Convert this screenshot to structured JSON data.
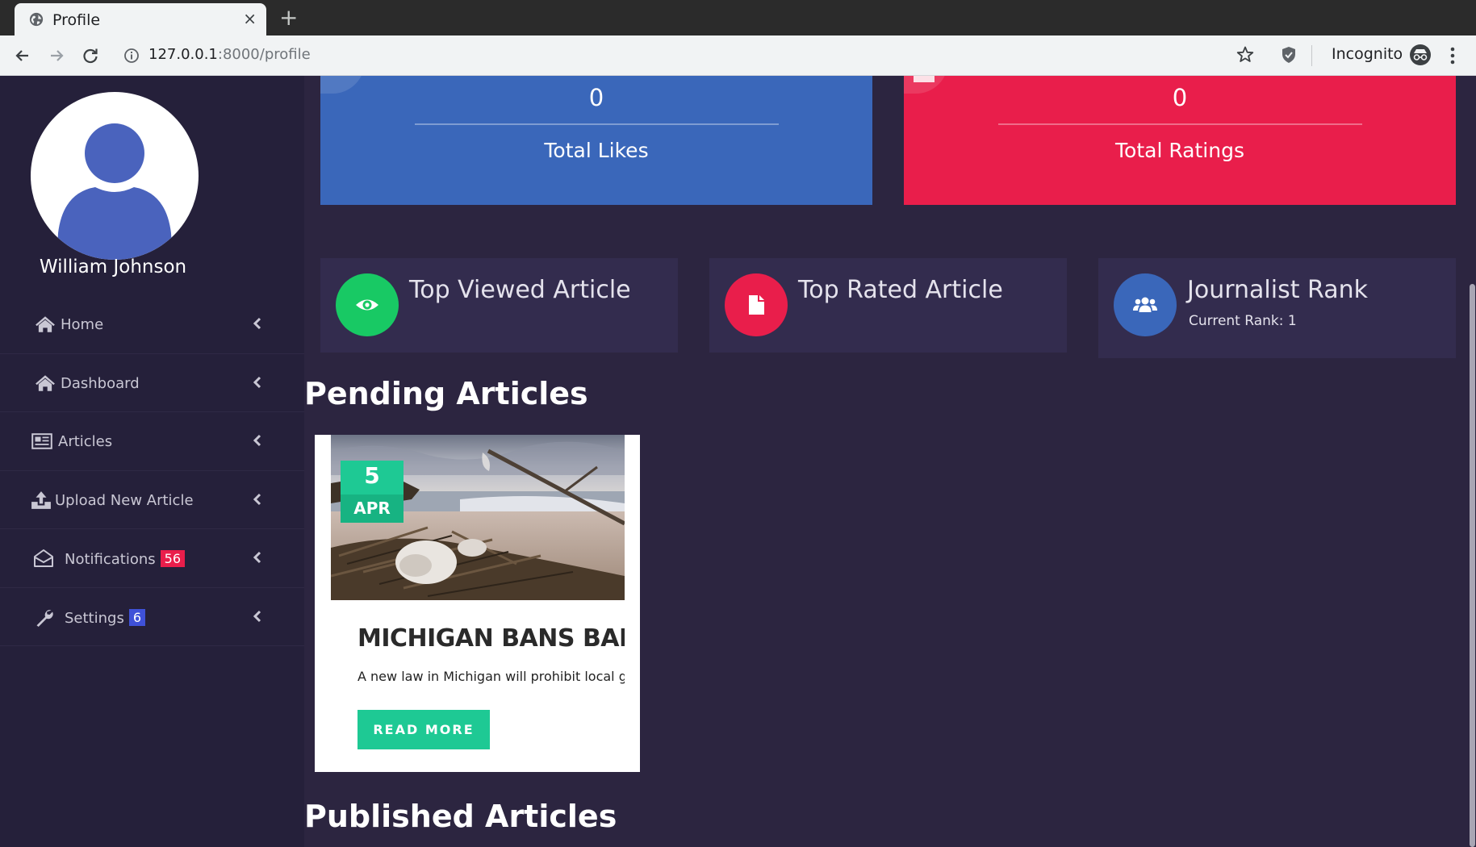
{
  "browser": {
    "tab_title": "Profile",
    "tab_close": "×",
    "new_tab": "+",
    "url_host": "127.0.0.1",
    "url_rest": ":8000/profile",
    "incognito_label": "Incognito"
  },
  "sidebar": {
    "user_name": "William Johnson",
    "items": [
      {
        "label": "Home",
        "icon": "home-icon"
      },
      {
        "label": "Dashboard",
        "icon": "home-icon"
      },
      {
        "label": "Articles",
        "icon": "newspaper-icon"
      },
      {
        "label": "Upload New Article",
        "icon": "upload-icon"
      },
      {
        "label": "Notifications",
        "icon": "envelope-icon",
        "badge": "56",
        "badge_color": "#e91e4b"
      },
      {
        "label": "Settings",
        "icon": "wrench-icon",
        "badge": "6",
        "badge_color": "#3f51d8"
      }
    ]
  },
  "stats": [
    {
      "value": "0",
      "label": "Total Likes",
      "color": "#3a67ba"
    },
    {
      "value": "0",
      "label": "Total Ratings",
      "color": "#e91e4b"
    }
  ],
  "info_cards": [
    {
      "title": "Top Viewed Article",
      "icon": "eye-icon",
      "color": "#18c964"
    },
    {
      "title": "Top Rated Article",
      "icon": "file-icon",
      "color": "#e91e4b"
    },
    {
      "title": "Journalist Rank",
      "subtitle": "Current Rank: 1",
      "icon": "users-icon",
      "color": "#3a67ba"
    }
  ],
  "sections": {
    "pending": "Pending Articles",
    "published": "Published Articles"
  },
  "pending_articles": [
    {
      "day": "5",
      "month": "APR",
      "title": "MICHIGAN BANS BANNING",
      "excerpt": "A new law in Michigan will prohibit local governments",
      "button": "READ MORE"
    }
  ]
}
